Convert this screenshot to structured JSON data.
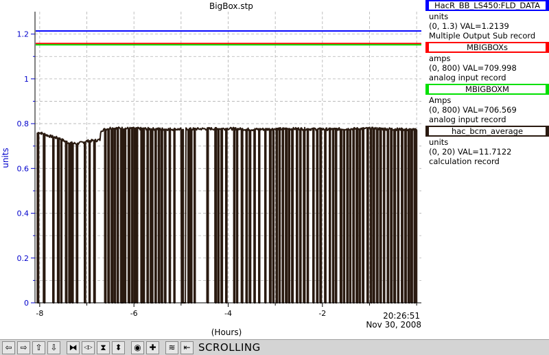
{
  "chart_data": {
    "type": "line",
    "title": "BigBox.stp",
    "ylabel": "units",
    "xlabel": "(Hours)",
    "xlim": [
      -8.1,
      0.1
    ],
    "ylim": [
      0,
      1.3
    ],
    "x_ticks": [
      -8,
      -7,
      -6,
      -5,
      -4,
      -3,
      -2,
      -1,
      0
    ],
    "x_tick_labels": [
      "-8",
      "",
      "-6",
      "",
      "-4",
      "",
      "-2",
      "",
      ""
    ],
    "y_ticks": [
      0,
      0.1,
      0.2,
      0.3,
      0.4,
      0.5,
      0.6,
      0.7,
      0.8,
      0.9,
      1.0,
      1.1,
      1.2
    ],
    "y_tick_labels": [
      "0",
      "",
      "0.2",
      "",
      "0.4",
      "",
      "0.6",
      "",
      "0.8",
      "",
      "1",
      "",
      "1.2"
    ],
    "time_label": "20:26:51",
    "date_label": "Nov 30, 2008",
    "grid": true,
    "series": [
      {
        "name": "HacR_BB_LS450:FLD_DATA",
        "color": "#0000ff",
        "style": "flat",
        "value": 1.2139
      },
      {
        "name": "MBIGBOXs",
        "color": "#ff0000",
        "style": "flat",
        "value": 1.158
      },
      {
        "name": "MBIGBOXM",
        "color": "#00e000",
        "style": "flat",
        "value": 1.152
      },
      {
        "name": "hac_bcm_average",
        "color": "#2a1a10",
        "style": "dropouts",
        "base": {
          "x": [
            -8.0,
            -7.8,
            -7.6,
            -7.4,
            -7.2,
            -7.0,
            -6.8,
            -6.72,
            -6.7,
            -6.5,
            -6.0,
            -5.5,
            -5.0,
            -4.5,
            -4.0,
            -3.5,
            -3.0,
            -2.5,
            -2.0,
            -1.5,
            -1.0,
            -0.5,
            0.0
          ],
          "y": [
            0.76,
            0.745,
            0.735,
            0.715,
            0.71,
            0.722,
            0.725,
            0.728,
            0.77,
            0.78,
            0.778,
            0.776,
            0.775,
            0.777,
            0.778,
            0.774,
            0.776,
            0.777,
            0.775,
            0.776,
            0.778,
            0.776,
            0.772
          ]
        },
        "dropouts": [
          -8.05,
          -7.92,
          -7.72,
          -7.62,
          -7.55,
          -7.45,
          -7.38,
          -7.32,
          -7.22,
          -7.05,
          -6.95,
          -6.85,
          -6.62,
          -6.55,
          -6.48,
          -6.42,
          -6.35,
          -6.28,
          -6.25,
          -6.2,
          -6.12,
          -6.05,
          -6.0,
          -5.95,
          -5.85,
          -5.8,
          -5.72,
          -5.65,
          -5.62,
          -5.55,
          -5.48,
          -5.42,
          -5.35,
          -5.25,
          -5.15,
          -4.98,
          -4.85,
          -4.8,
          -4.72,
          -4.45,
          -4.28,
          -4.22,
          -4.15,
          -4.05,
          -3.88,
          -3.82,
          -3.72,
          -3.62,
          -3.55,
          -3.45,
          -3.35,
          -3.22,
          -3.12,
          -3.05,
          -2.98,
          -2.92,
          -2.85,
          -2.78,
          -2.72,
          -2.65,
          -2.55,
          -2.48,
          -2.4,
          -2.32,
          -2.2,
          -2.12,
          -2.05,
          -1.95,
          -1.85,
          -1.78,
          -1.72,
          -1.62,
          -1.55,
          -1.48,
          -1.42,
          -1.35,
          -1.28,
          -1.22,
          -1.15,
          -1.05,
          -0.98,
          -0.92,
          -0.85,
          -0.78,
          -0.7,
          -0.62,
          -0.55,
          -0.48,
          -0.4,
          -0.32,
          -0.25,
          -0.18,
          -0.12,
          -0.05,
          0.0
        ],
        "gaps": [
          [
            -5.0,
            -4.9
          ]
        ],
        "value": 0.772
      }
    ]
  },
  "legend": [
    {
      "name": "HacR_BB_LS450:FLD_DATA",
      "color": "#0000ff",
      "units": "units",
      "range": "(0, 1.3) VAL=1.2139",
      "record": "Multiple Output Sub record"
    },
    {
      "name": "MBIGBOXs",
      "color": "#ff0000",
      "units": "amps",
      "range": "(0, 800) VAL=709.998",
      "record": "analog input record"
    },
    {
      "name": "MBIGBOXM",
      "color": "#00e000",
      "units": "Amps",
      "range": "(0, 800) VAL=706.569",
      "record": "analog input record"
    },
    {
      "name": "hac_bcm_average",
      "color": "#2a1a10",
      "units": "units",
      "range": "(0, 20) VAL=11.7122",
      "record": "calculation record"
    }
  ],
  "toolbar": {
    "status": "SCROLLING",
    "buttons": [
      {
        "name": "pan-left-button",
        "icon": "arrow-left-icon",
        "glyph": "⇦"
      },
      {
        "name": "pan-right-button",
        "icon": "arrow-right-icon",
        "glyph": "⇨"
      },
      {
        "name": "pan-up-button",
        "icon": "arrow-up-icon",
        "glyph": "⇧"
      },
      {
        "name": "pan-down-button",
        "icon": "arrow-down-icon",
        "glyph": "⇩"
      },
      {
        "name": "zoom-in-x-button",
        "icon": "zoom-in-x-icon",
        "glyph": "⧓"
      },
      {
        "name": "zoom-out-x-button",
        "icon": "zoom-out-x-icon",
        "glyph": "◁▷"
      },
      {
        "name": "zoom-in-y-button",
        "icon": "zoom-in-y-icon",
        "glyph": "⧗"
      },
      {
        "name": "zoom-out-y-button",
        "icon": "zoom-out-y-icon",
        "glyph": "⬍"
      },
      {
        "name": "auto-scale-button",
        "icon": "target-icon",
        "glyph": "◉"
      },
      {
        "name": "center-button",
        "icon": "plus-icon",
        "glyph": "✚"
      },
      {
        "name": "style-button",
        "icon": "waveform-icon",
        "glyph": "≋"
      },
      {
        "name": "scroll-mode-button",
        "icon": "scroll-icon",
        "glyph": "⇤"
      }
    ]
  }
}
